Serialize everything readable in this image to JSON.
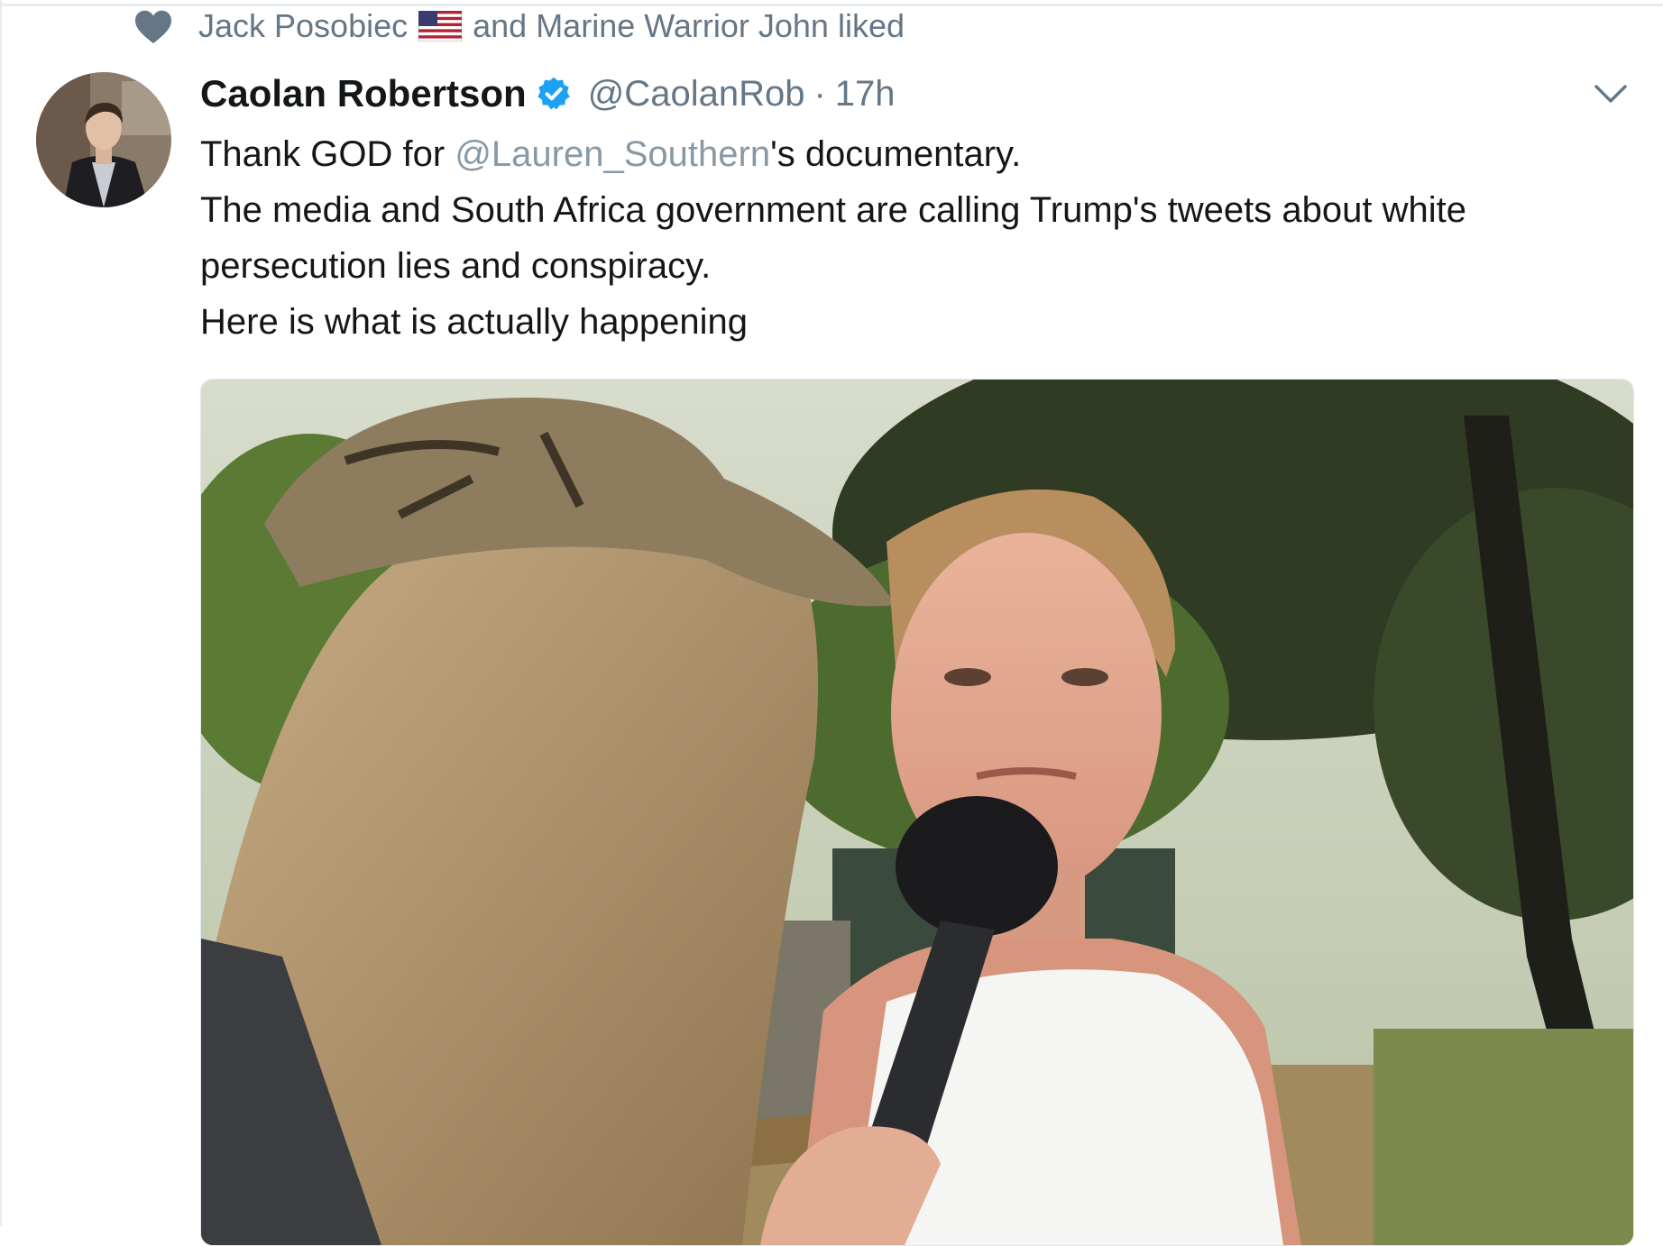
{
  "social_context": {
    "icon": "heart-icon",
    "user_one": "Jack Posobiec",
    "flag": "us-flag-icon",
    "rest": "and Marine Warrior John liked"
  },
  "tweet": {
    "author_name": "Caolan Robertson",
    "verified_icon": "verified-badge-icon",
    "handle": "@CaolanRob",
    "separator": "·",
    "time": "17h",
    "menu_icon": "chevron-down-icon",
    "line1_before": "Thank GOD for ",
    "line1_mention": "@Lauren_Southern",
    "line1_after": "'s documentary.",
    "line2": "The media and South Africa government are calling Trump's tweets about white persecution lies and conspiracy.",
    "line3": "Here is what is actually happening"
  },
  "colors": {
    "text": "#14171a",
    "muted": "#657786",
    "mention": "#8899a6",
    "verified": "#1da1f2"
  }
}
